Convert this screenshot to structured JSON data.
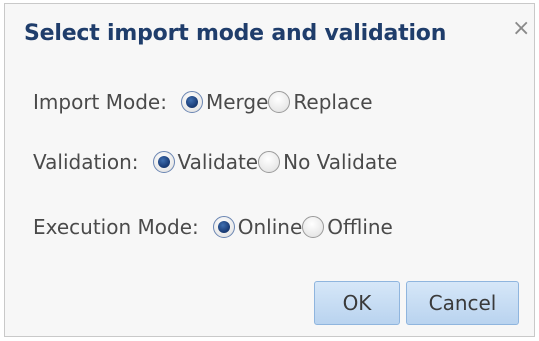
{
  "dialog": {
    "title": "Select import mode and validation",
    "close_glyph": "×"
  },
  "import_mode": {
    "label": "Import Mode:",
    "options": [
      {
        "label": "Merge",
        "selected": true
      },
      {
        "label": "Replace",
        "selected": false
      }
    ]
  },
  "validation": {
    "label": "Validation:",
    "options": [
      {
        "label": "Validate",
        "selected": true
      },
      {
        "label": "No Validate",
        "selected": false
      }
    ]
  },
  "execution_mode": {
    "label": "Execution Mode:",
    "options": [
      {
        "label": "Online",
        "selected": true
      },
      {
        "label": "Offline",
        "selected": false
      }
    ]
  },
  "buttons": {
    "ok": "OK",
    "cancel": "Cancel"
  },
  "colors": {
    "title": "#1f3d6b",
    "button_bg": "#c8ddf3",
    "button_border": "#8fb5de",
    "radio_selected": "#1c3f7a"
  }
}
